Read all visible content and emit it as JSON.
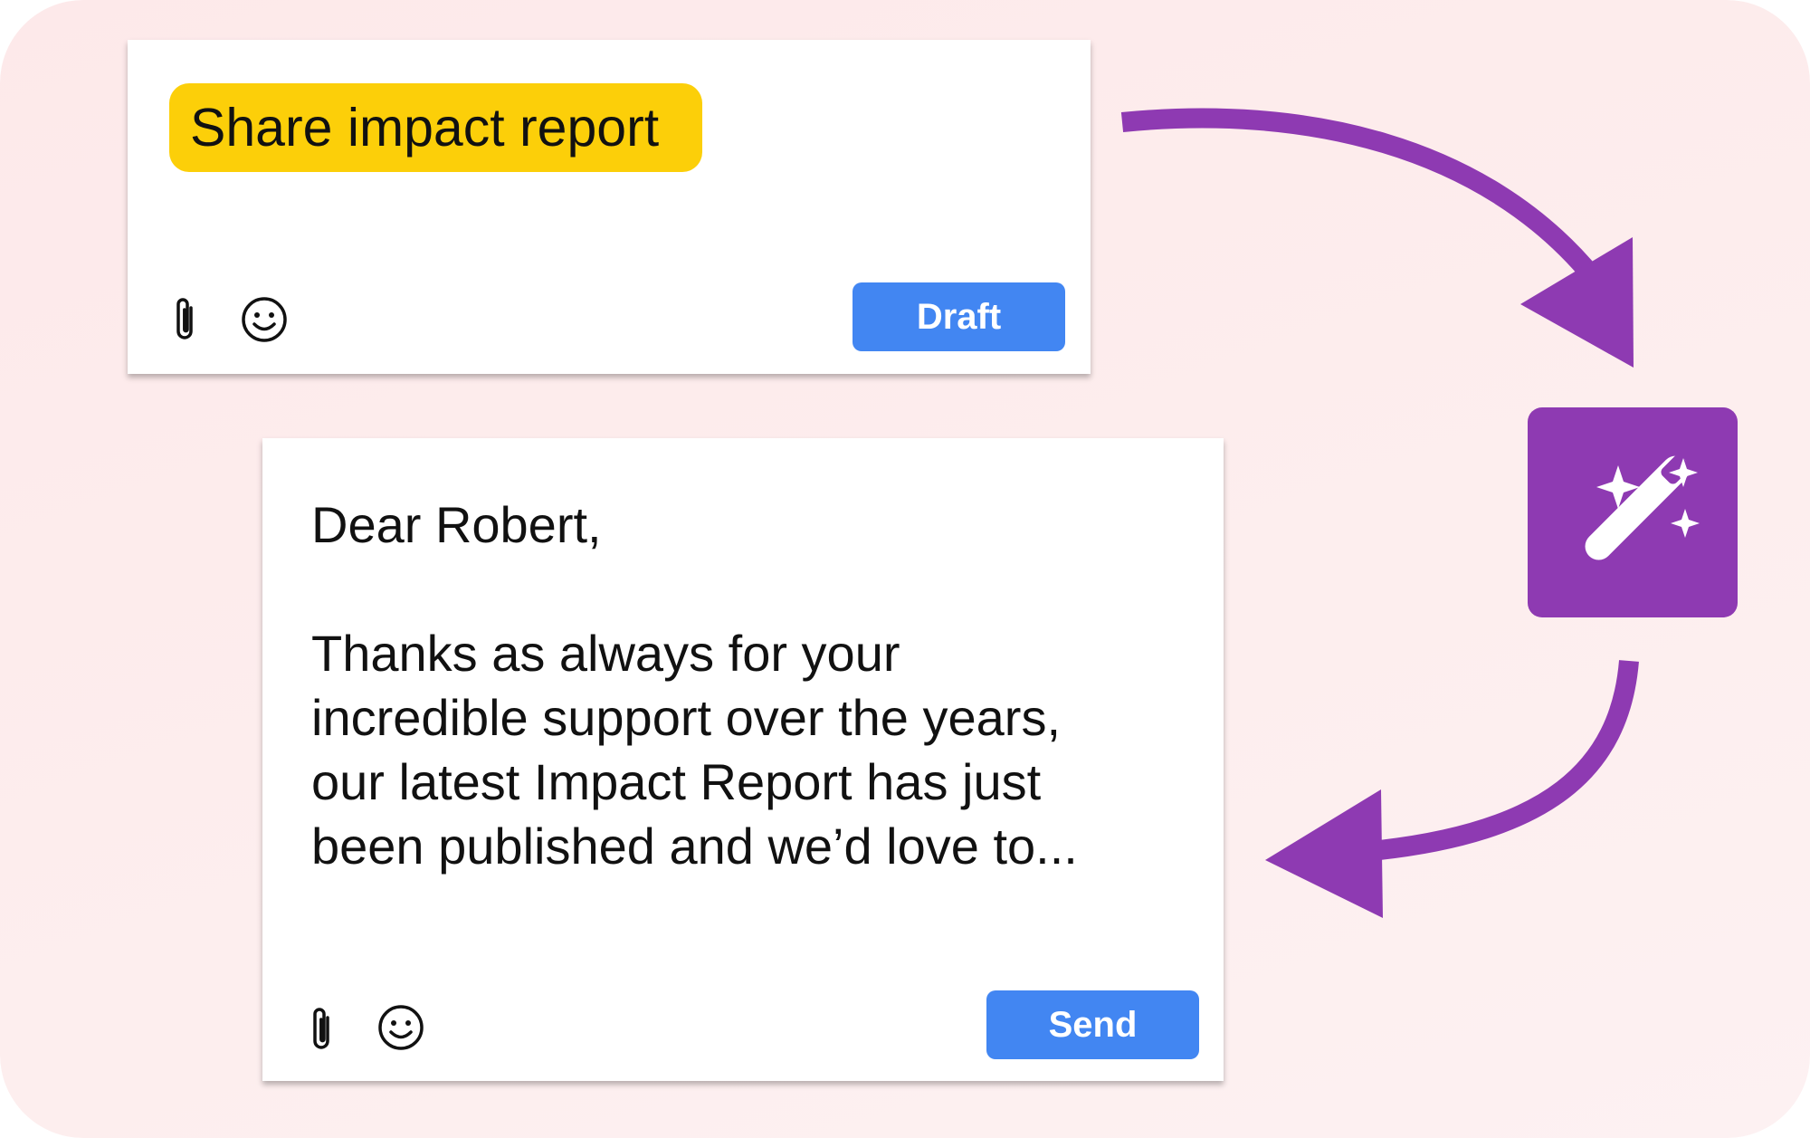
{
  "colors": {
    "background": "#fde9ea",
    "accent_purple": "#8e3ab2",
    "chip_yellow": "#fccf09",
    "button_blue": "#4286f2"
  },
  "draft_card": {
    "prompt_text": "Share impact report",
    "attach_icon": "paperclip-icon",
    "emoji_icon": "smiley-icon",
    "button_label": "Draft"
  },
  "ai_step": {
    "icon": "magic-wand-icon"
  },
  "reply_card": {
    "greeting": "Dear Robert,",
    "body_lines": [
      "Thanks as always for your",
      "incredible support over the years,",
      "our latest Impact Report has just",
      "been published and we’d love to..."
    ],
    "attach_icon": "paperclip-icon",
    "emoji_icon": "smiley-icon",
    "button_label": "Send"
  }
}
